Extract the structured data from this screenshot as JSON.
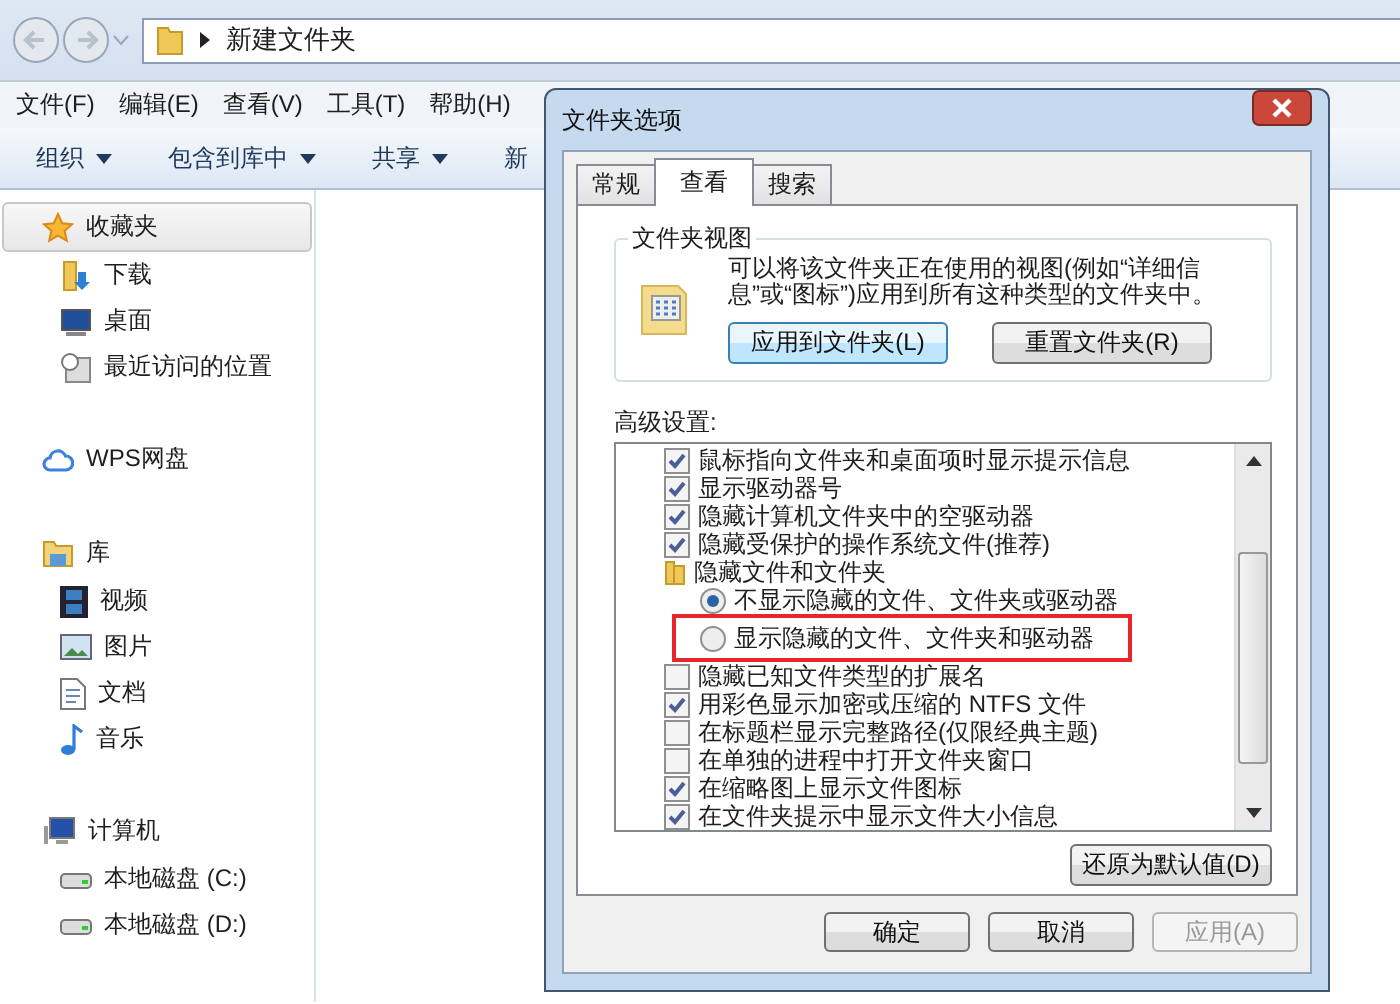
{
  "explorer": {
    "address": {
      "path": "新建文件夹"
    },
    "menu": [
      "文件(F)",
      "编辑(E)",
      "查看(V)",
      "工具(T)",
      "帮助(H)"
    ],
    "toolbar": [
      {
        "label": "组织",
        "dropdown": true
      },
      {
        "label": "包含到库中",
        "dropdown": true
      },
      {
        "label": "共享",
        "dropdown": true
      },
      {
        "label": "新",
        "dropdown": false
      }
    ],
    "nav": [
      {
        "label": "收藏夹",
        "selected": true,
        "children": [
          {
            "label": "下载"
          },
          {
            "label": "桌面"
          },
          {
            "label": "最近访问的位置"
          }
        ]
      },
      {
        "label": "WPS网盘",
        "selected": false
      },
      {
        "label": "库",
        "selected": false,
        "children": [
          {
            "label": "视频"
          },
          {
            "label": "图片"
          },
          {
            "label": "文档"
          },
          {
            "label": "音乐"
          }
        ]
      },
      {
        "label": "计算机",
        "selected": false,
        "children": [
          {
            "label": "本地磁盘 (C:)"
          },
          {
            "label": "本地磁盘 (D:)"
          }
        ]
      }
    ]
  },
  "dialog": {
    "title": "文件夹选项",
    "tabs": [
      {
        "label": "常规",
        "selected": false
      },
      {
        "label": "查看",
        "selected": true
      },
      {
        "label": "搜索",
        "selected": false
      }
    ],
    "folder_views": {
      "heading": "文件夹视图",
      "description": "可以将该文件夹正在使用的视图(例如“详细信息”或“图标”)应用到所有这种类型的文件夹中。",
      "buttons": [
        "应用到文件夹(L)",
        "重置文件夹(R)"
      ]
    },
    "advanced": {
      "heading": "高级设置:",
      "items": [
        {
          "kind": "checkbox",
          "label": "鼠标指向文件夹和桌面项时显示提示信息",
          "checked": true
        },
        {
          "kind": "checkbox",
          "label": "显示驱动器号",
          "checked": true
        },
        {
          "kind": "checkbox",
          "label": "隐藏计算机文件夹中的空驱动器",
          "checked": true
        },
        {
          "kind": "checkbox",
          "label": "隐藏受保护的操作系统文件(推荐)",
          "checked": true
        },
        {
          "kind": "folder",
          "label": "隐藏文件和文件夹",
          "children": [
            {
              "kind": "radio",
              "label": "不显示隐藏的文件、文件夹或驱动器",
              "selected": true,
              "highlighted": false
            },
            {
              "kind": "radio",
              "label": "显示隐藏的文件、文件夹和驱动器",
              "selected": false,
              "highlighted": true
            }
          ]
        },
        {
          "kind": "checkbox",
          "label": "隐藏已知文件类型的扩展名",
          "checked": false
        },
        {
          "kind": "checkbox",
          "label": "用彩色显示加密或压缩的 NTFS 文件",
          "checked": true
        },
        {
          "kind": "checkbox",
          "label": "在标题栏显示完整路径(仅限经典主题)",
          "checked": false
        },
        {
          "kind": "checkbox",
          "label": "在单独的进程中打开文件夹窗口",
          "checked": false
        },
        {
          "kind": "checkbox",
          "label": "在缩略图上显示文件图标",
          "checked": true
        },
        {
          "kind": "checkbox",
          "label": "在文件夹提示中显示文件大小信息",
          "checked": true
        }
      ]
    },
    "restore_button": "还原为默认值(D)",
    "buttons": [
      {
        "label": "确定",
        "disabled": false
      },
      {
        "label": "取消",
        "disabled": false
      },
      {
        "label": "应用(A)",
        "disabled": true
      }
    ]
  }
}
